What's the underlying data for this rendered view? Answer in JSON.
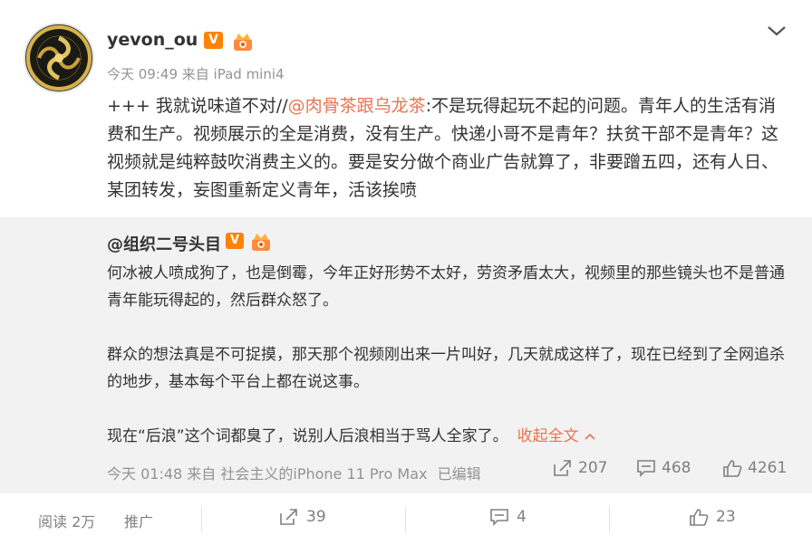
{
  "post": {
    "username": "yevon_ou",
    "verified_badge": "V",
    "timestamp": "今天 09:49",
    "source": "来自 iPad mini4",
    "content_prefix": "+++ 我就说味道不对//",
    "mention": "@肉骨茶跟乌龙茶",
    "content_rest": ":不是玩得起玩不起的问题。青年人的生活有消费和生产。视频展示的全是消费，没有生产。快递小哥不是青年？扶贫干部不是青年？这视频就是纯粹鼓吹消费主义的。要是安分做个商业广告就算了，非要蹭五四，还有人日、某团转发，妄图重新定义青年，活该挨喷"
  },
  "repost": {
    "username": "@组织二号头目",
    "verified_badge": "V",
    "paragraph1": "何冰被人喷成狗了，也是倒霉，今年正好形势不太好，劳资矛盾太大，视频里的那些镜头也不是普通青年能玩得起的，然后群众怒了。",
    "paragraph2": "群众的想法真是不可捉摸，那天那个视频刚出来一片叫好，几天就成这样了，现在已经到了全网追杀的地步，基本每个平台上都在说这事。",
    "paragraph3": "现在“后浪”这个词都臭了，说别人后浪相当于骂人全家了。",
    "collapse_label": "收起全文",
    "timestamp": "今天 01:48",
    "source": "来自 社会主义的iPhone 11 Pro Max",
    "edited": "已编辑",
    "reposts": "207",
    "comments": "468",
    "likes": "4261"
  },
  "footer": {
    "reads": "阅读 2万",
    "promote": "推广",
    "reposts": "39",
    "comments": "4",
    "likes": "23"
  },
  "colors": {
    "accent": "#eb7350",
    "badge": "#ff8200",
    "meta": "#939393",
    "repost_bg": "#f2f2f2"
  },
  "icons": [
    "avatar",
    "verified-v-icon",
    "crown-badge-icon",
    "chevron-down-icon",
    "chevron-up-icon",
    "repost-icon",
    "comment-icon",
    "like-icon"
  ]
}
